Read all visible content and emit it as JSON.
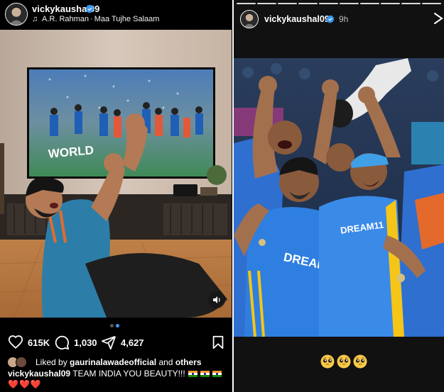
{
  "post": {
    "username": "vickykaushal09",
    "music": {
      "artist": "A.R. Rahman",
      "separator": "·",
      "song": "Maa Tujhe Salaam"
    },
    "actions": {
      "likes": "615K",
      "comments": "1,030",
      "shares": "4,627"
    },
    "liked_by": {
      "prefix": "Liked by",
      "user": "gaurinalawadeofficial",
      "connector": "and",
      "others": "others"
    },
    "caption": {
      "username": "vickykaushal09",
      "text": "TEAM INDIA YOU BEAUTY!!!",
      "hearts": "❤️❤️❤️"
    },
    "tv": {
      "banner": "WORLD"
    },
    "carousel": {
      "count": 2,
      "active": 2
    }
  },
  "story": {
    "username": "vickykaushal09",
    "time": "9h",
    "jersey_text_1": "DREAM",
    "jersey_text_2": "DREAM11",
    "segments": 10,
    "emojis": [
      "🥺",
      "🥺",
      "🥺"
    ]
  },
  "colors": {
    "verified": "#3797f0",
    "carousel_active": "#3b9cf0",
    "india_blue": "#2f7fe0",
    "background": "#000000"
  },
  "icons": [
    "verified-icon",
    "music-note-icon",
    "mute-icon",
    "heart-icon",
    "comment-icon",
    "share-icon",
    "bookmark-icon",
    "close-icon",
    "pleading-face-icon"
  ]
}
